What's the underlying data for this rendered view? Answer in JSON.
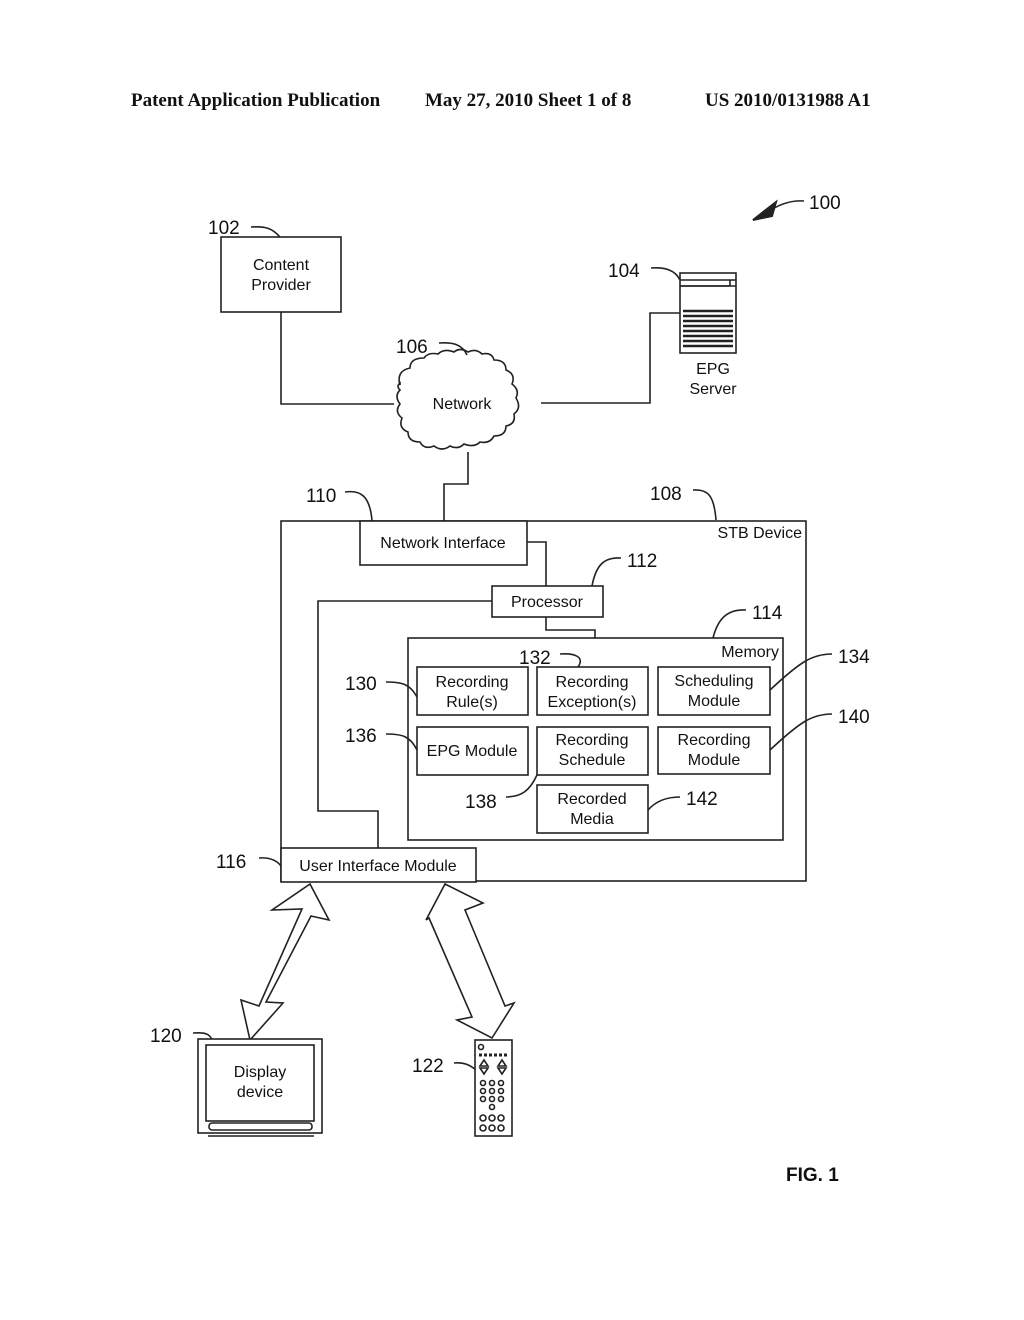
{
  "header": {
    "left": "Patent Application Publication",
    "center": "May 27, 2010  Sheet 1 of 8",
    "right": "US 2010/0131988 A1"
  },
  "figure": {
    "label": "FIG. 1",
    "system_ref": "100",
    "content_provider": {
      "ref": "102",
      "line1": "Content",
      "line2": "Provider"
    },
    "epg_server": {
      "ref": "104",
      "line1": "EPG",
      "line2": "Server",
      "icon": "server-icon"
    },
    "network": {
      "ref": "106",
      "label": "Network",
      "icon": "cloud-icon"
    },
    "stb_device": {
      "ref": "108",
      "label": "STB Device"
    },
    "network_interface": {
      "ref": "110",
      "label": "Network Interface"
    },
    "processor": {
      "ref": "112",
      "label": "Processor"
    },
    "memory": {
      "ref": "114",
      "label": "Memory"
    },
    "user_interface_module": {
      "ref": "116",
      "label": "User Interface Module"
    },
    "display_device": {
      "ref": "120",
      "line1": "Display",
      "line2": "device",
      "icon": "tv-icon"
    },
    "remote_control": {
      "ref": "122",
      "icon": "remote-control-icon"
    },
    "modules": {
      "recording_rules": {
        "ref": "130",
        "line1": "Recording",
        "line2": "Rule(s)"
      },
      "recording_exceptions": {
        "ref": "132",
        "line1": "Recording",
        "line2": "Exception(s)"
      },
      "scheduling_module": {
        "ref": "134",
        "line1": "Scheduling",
        "line2": "Module"
      },
      "epg_module": {
        "ref": "136",
        "label": "EPG Module"
      },
      "recording_schedule": {
        "ref": "138",
        "line1": "Recording",
        "line2": "Schedule"
      },
      "recording_module": {
        "ref": "140",
        "line1": "Recording",
        "line2": "Module"
      },
      "recorded_media": {
        "ref": "142",
        "line1": "Recorded",
        "line2": "Media"
      }
    }
  }
}
